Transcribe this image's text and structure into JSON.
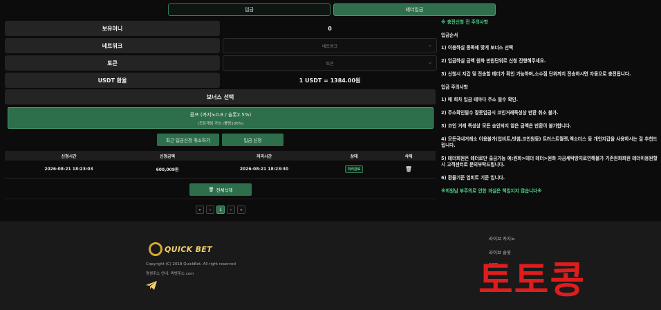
{
  "tabs": [
    {
      "label": "입금"
    },
    {
      "label": "테더입금"
    }
  ],
  "form": {
    "balance_label": "보유머니",
    "balance_value": "0",
    "network_label": "네트워크",
    "network_selected": "네트워크",
    "token_label": "토큰",
    "token_selected": "토큰",
    "rate_label": "USDT 환율",
    "rate_value": "1 USDT = 1384.00원"
  },
  "bonus": {
    "header": "보너스 선택",
    "option_title": "콤프 (카지노0.8 / 슬롯2.5%)",
    "option_sub": "(모든게임 가능 (롤링100%)"
  },
  "buttons": {
    "cancel_recent": "최근 입금신청 취소하기",
    "apply": "입금 신청",
    "delete_all": "전체삭제",
    "delete_all_icon": "🗑"
  },
  "table": {
    "headers": [
      "신청시간",
      "신청금액",
      "처리시간",
      "상태",
      "삭제"
    ],
    "rows": [
      {
        "requested": "2026-08-21 18:23:03",
        "amount": "600,009원",
        "processed": "2026-08-21 18:23:30",
        "status": "처리완료"
      }
    ]
  },
  "pagination": {
    "first": "«",
    "prev": "‹",
    "current": "1",
    "next": "›",
    "last": "»"
  },
  "notes": {
    "title": "※ 충전신청 전 주의사항",
    "order_heading": "입금순서",
    "step1": "1) 이용하실 종목에 맞게 보너스 선택",
    "step2": "2) 입금하실 금액 원화 만원단위로 신청 진행해주세요.",
    "step3": "3) 신청시 지갑 및 전송할 테더가 확인 가능하며,소수점 단위까지 전송하시면 자동으로 충전됩니다.",
    "caution_heading": "입금 주의사항",
    "c1": "1) 매 회차 입금 테마다 주소 필수 확인.",
    "c2": "2) 주소확인필수 잘못입금시 코인거래특성상 반환 취소 불가.",
    "c3": "3) 코인 거래 특성상 모든 승인되지 않은 금액은 반환이 불가합니다.",
    "c4": "4) 모든국내거래소 이용불가(업비트,빗썸,코인원등) 트러스트월렛,엑소더스 등 개인지갑을 사용하시는 걸 추천드립니다.",
    "c5": "5) 테더회원은 테더로만 출금가능 예:원화>테더 테더>원화 자금세탁방지로인해불가 기존원화회원 테더이용원할시 고객센터로 문의부탁드립니다.",
    "c6": "6) 환율기준 업비트 기준 입니다.",
    "warning": "※회원님 부주의로 인한 과실은 책임지지 않습니다※"
  },
  "footer": {
    "logo_text": "QUICK BET",
    "copyright": "Copyright (C) 2018 QuickBet. All right reserved",
    "address": "평생주소 안내: 퀵벳주소.com",
    "links": [
      "라이브 카지노",
      "라이브 슬롯",
      "BET"
    ],
    "watermark": "토토콩"
  },
  "colors": {
    "accent": "#2d6f4b",
    "highlight": "#4ed486",
    "watermark": "#e01c1c"
  }
}
